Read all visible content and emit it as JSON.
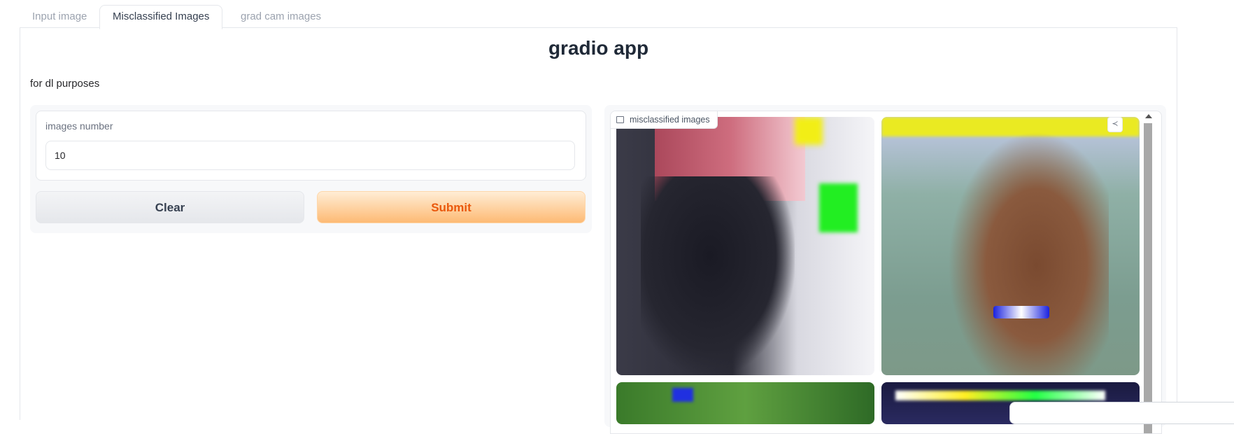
{
  "tabs": [
    {
      "label": "Input image",
      "active": false
    },
    {
      "label": "Misclassified Images",
      "active": true
    },
    {
      "label": "grad cam images",
      "active": false
    }
  ],
  "app": {
    "title": "gradio app",
    "description": "for dl purposes"
  },
  "inputs": {
    "images_number": {
      "label": "images number",
      "value": "10"
    }
  },
  "buttons": {
    "clear": "Clear",
    "submit": "Submit"
  },
  "gallery": {
    "label": "misclassified images",
    "icon": "image-icon",
    "share_icon": "share-icon"
  },
  "colors": {
    "accent": "#ea580c",
    "submit_bg": "#fdba74",
    "border": "#e5e7eb"
  }
}
